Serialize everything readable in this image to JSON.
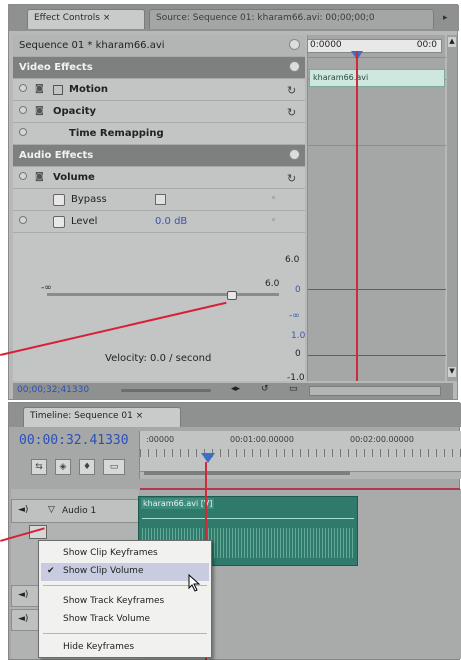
{
  "effect_controls": {
    "tab_effect_controls": "Effect Controls",
    "tab_source": "Source: Sequence 01: kharam66.avi: 00;00;00;0",
    "sequence_label": "Sequence 01 * kharam66.avi",
    "time_input": "0:0000",
    "time_input_right": "00:0",
    "clip_name": "kharam66.avi",
    "video_effects_header": "Video Effects",
    "motion_label": "Motion",
    "opacity_label": "Opacity",
    "time_remapping_label": "Time Remapping",
    "audio_effects_header": "Audio Effects",
    "volume_label": "Volume",
    "bypass_label": "Bypass",
    "level_label": "Level",
    "level_value": "0.0 dB",
    "scale_top": "6.0",
    "slider_min": "-∞",
    "slider_max": "6.0",
    "val_zero": "0",
    "val_neg_inf": "-∞",
    "val_1_0": "1.0",
    "val_neg_1_0": "-1.0",
    "velocity_label": "Velocity: 0.0 / second",
    "bottom_timecode": "00;00;32;41330"
  },
  "timeline": {
    "tab_label": "Timeline: Sequence 01",
    "timecode": "00:00:32.41330",
    "ruler_marks": [
      ":00000",
      "00:01:00.00000",
      "00:02:00.00000"
    ],
    "audio_track_label": "Audio 1",
    "clip_label": "kharam66.avi [V]"
  },
  "context_menu": {
    "items": [
      {
        "label": "Show Clip Keyframes",
        "checked": false,
        "selected": false
      },
      {
        "label": "Show Clip Volume",
        "checked": true,
        "selected": true
      },
      {
        "label": "Show Track Keyframes",
        "checked": false,
        "selected": false
      },
      {
        "label": "Show Track Volume",
        "checked": false,
        "selected": false
      },
      {
        "label": "Hide Keyframes",
        "checked": false,
        "selected": false
      }
    ],
    "checkmark": "✔"
  },
  "colors": {
    "accent_blue": "#2c4fb8",
    "playhead_red": "#cf2a3c",
    "clip_teal": "#2f7a6a",
    "menu_highlight": "#c9cce0"
  }
}
